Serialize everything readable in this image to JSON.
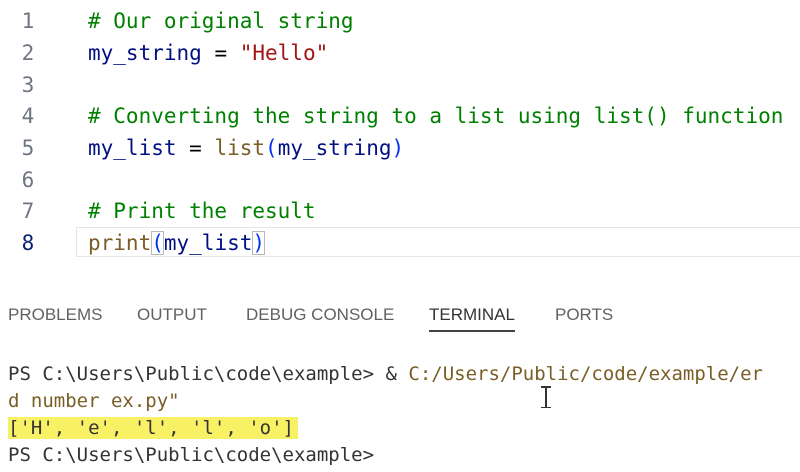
{
  "editor": {
    "lines": [
      {
        "number": "1",
        "comment": "# Our original string"
      },
      {
        "number": "2",
        "var": "my_string",
        "op": " = ",
        "string": "\"Hello\""
      },
      {
        "number": "3"
      },
      {
        "number": "4",
        "comment": "# Converting the string to a list using list() function"
      },
      {
        "number": "5",
        "var": "my_list",
        "op": " = ",
        "func": "list",
        "open": "(",
        "arg": "my_string",
        "close": ")"
      },
      {
        "number": "6"
      },
      {
        "number": "7",
        "comment": "# Print the result"
      },
      {
        "number": "8",
        "func": "print",
        "open": "(",
        "arg": "my_list",
        "close": ")"
      }
    ],
    "active_line": "8"
  },
  "panel": {
    "tabs": [
      {
        "label": "PROBLEMS"
      },
      {
        "label": "OUTPUT"
      },
      {
        "label": "DEBUG CONSOLE"
      },
      {
        "label": "TERMINAL",
        "active": true
      },
      {
        "label": "PORTS"
      }
    ]
  },
  "terminal": {
    "line1_prompt": "PS C:\\Users\\Public\\code\\example> & ",
    "line1_path": "C:/Users/Public/code/example/er",
    "line2": "d number ex.py\"",
    "output": "['H', 'e', 'l', 'l', 'o']",
    "line4_prompt": "PS C:\\Users\\Public\\code\\example>"
  },
  "colors": {
    "comment": "#008000",
    "variable": "#001080",
    "string": "#a31515",
    "function": "#795e26",
    "paren": "#0431fa",
    "highlight": "#f8f166"
  }
}
